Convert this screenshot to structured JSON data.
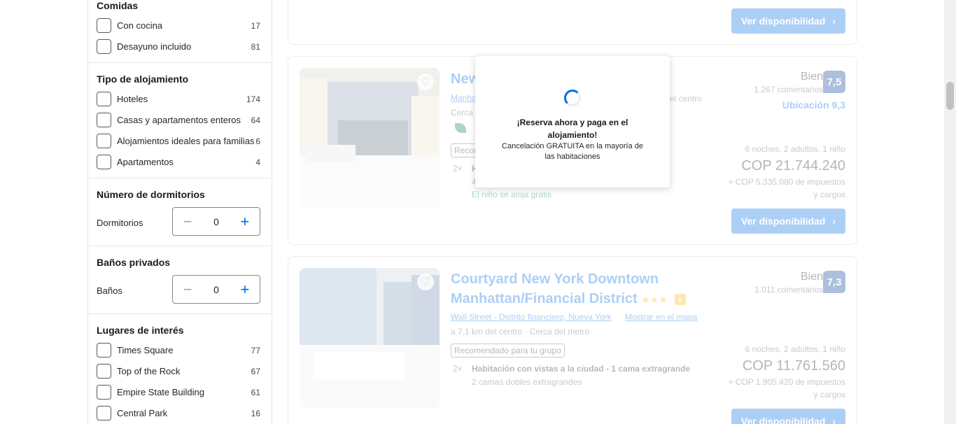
{
  "filters": {
    "comidas": {
      "title": "Comidas",
      "items": [
        {
          "label": "Con cocina",
          "count": "17"
        },
        {
          "label": "Desayuno incluido",
          "count": "81"
        }
      ]
    },
    "tipo": {
      "title": "Tipo de alojamiento",
      "items": [
        {
          "label": "Hoteles",
          "count": "174"
        },
        {
          "label": "Casas y apartamentos enteros",
          "count": "64"
        },
        {
          "label": "Alojamientos ideales para familias",
          "count": "6"
        },
        {
          "label": "Apartamentos",
          "count": "4"
        }
      ]
    },
    "dormitorios": {
      "title": "Número de dormitorios",
      "label": "Dormitorios",
      "value": "0"
    },
    "banos": {
      "title": "Baños privados",
      "label": "Baños",
      "value": "0"
    },
    "lugares": {
      "title": "Lugares de interés",
      "items": [
        {
          "label": "Times Square",
          "count": "77"
        },
        {
          "label": "Top of the Rock",
          "count": "67"
        },
        {
          "label": "Empire State Building",
          "count": "61"
        },
        {
          "label": "Central Park",
          "count": "16"
        }
      ]
    }
  },
  "cards": {
    "top": {
      "cta": "Ver disponibilidad"
    },
    "hotel1": {
      "name": "New",
      "location": "Manha",
      "location_tail": "el centro",
      "meta": "Cerca d",
      "tag": "Recom",
      "room_qty": "2×",
      "room_name": "H",
      "room_sub": "4",
      "child": "El niño se aloja gratis",
      "rating_word": "Bien",
      "reviews": "1.267 comentarios",
      "score": "7,5",
      "ubicacion": "Ubicación 9,3",
      "nights": "6 noches, 2 adultos, 1 niño",
      "price": "COP 21.744.240",
      "taxes": "+ COP 5.335.080 de impuestos y cargos",
      "cta": "Ver disponibilidad"
    },
    "hotel2": {
      "name_line1": "Courtyard New York Downtown",
      "name_line2": "Manhattan/Financial District",
      "stars": "★★★",
      "location": "Wall Street - Distrito financiero, Nueva York",
      "map": "Mostrar en el mapa",
      "meta": "a 7,1 km del centro · Cerca del metro",
      "tag": "Recomendado para tu grupo",
      "room_qty": "2×",
      "room_name": "Habitación con vistas a la ciudad - 1 cama extragrande",
      "room_sub": "2 camas dobles extragrandes",
      "rating_word": "Bien",
      "reviews": "1.011 comentarios",
      "score": "7,3",
      "nights": "6 noches, 2 adultos, 1 niño",
      "price": "COP 11.761.560",
      "taxes": "+ COP 1.905.420 de impuestos y cargos",
      "cta": "Ver disponibilidad"
    }
  },
  "popup": {
    "title": "¡Reserva ahora y paga en el alojamiento!",
    "subtitle": "Cancelación GRATUITA en la mayoría de las habitaciones"
  }
}
